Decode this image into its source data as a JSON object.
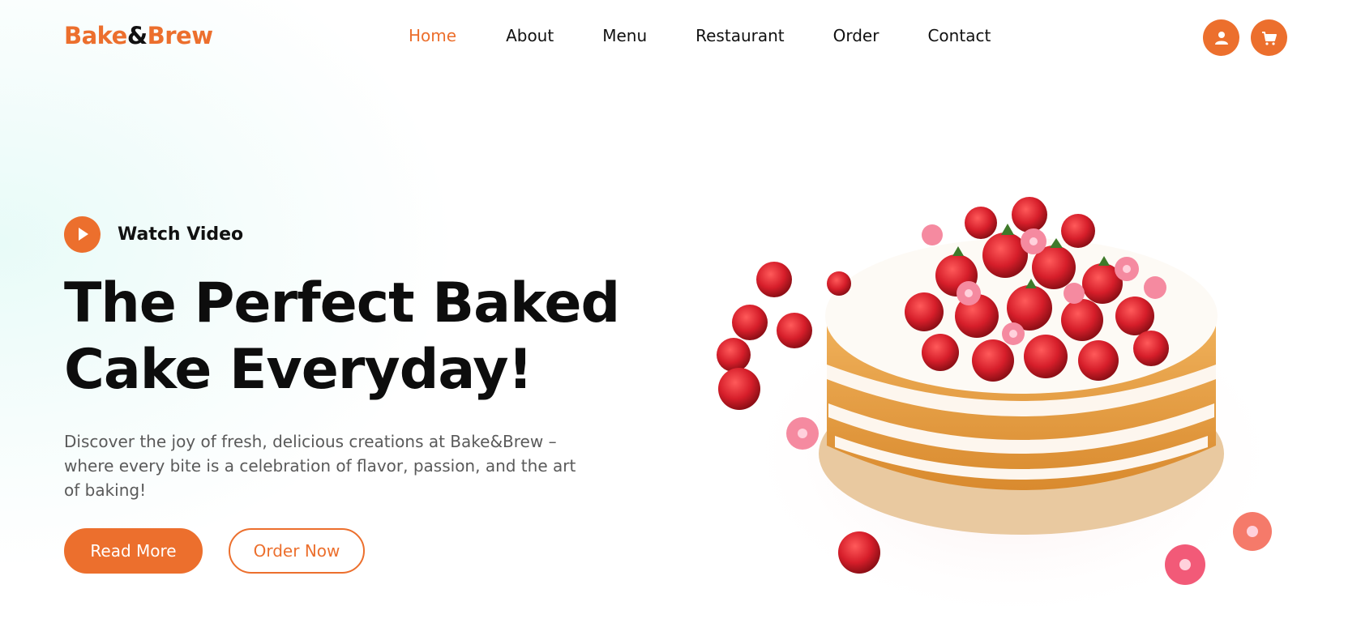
{
  "brand": {
    "name_part1": "Bake",
    "name_amp": "&",
    "name_part2": "Brew"
  },
  "nav": {
    "items": [
      {
        "label": "Home",
        "active": true
      },
      {
        "label": "About",
        "active": false
      },
      {
        "label": "Menu",
        "active": false
      },
      {
        "label": "Restaurant",
        "active": false
      },
      {
        "label": "Order",
        "active": false
      },
      {
        "label": "Contact",
        "active": false
      }
    ]
  },
  "header_icons": {
    "user": "user-icon",
    "cart": "cart-icon"
  },
  "hero": {
    "watch_label": "Watch Video",
    "title_line1": "The Perfect Baked",
    "title_line2": "Cake Everyday!",
    "description": "Discover the joy of fresh, delicious creations at Bake&Brew – where every bite is a celebration of flavor, passion, and the art of baking!",
    "read_more_label": "Read More",
    "order_now_label": "Order Now"
  },
  "colors": {
    "accent": "#ec6f2d",
    "text": "#111111",
    "muted": "#5a5a5a"
  }
}
